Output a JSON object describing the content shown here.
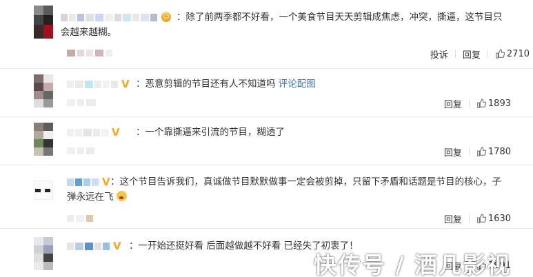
{
  "comments": [
    {
      "text": "：除了前两季都不好看，一个美食节目天天剪辑成焦虑，冲突，撕逼，这节目只",
      "text_line2": "会越来越糊。",
      "report_label": "投诉",
      "reply_label": "回复",
      "likes": "2710"
    },
    {
      "text": "：恶意剪辑的节目还有人不知道吗 ",
      "link": "评论配图",
      "reply_label": "回复",
      "likes": "1893"
    },
    {
      "text": "：一个靠撕逼来引流的节目，糊透了",
      "reply_label": "回复",
      "likes": "1780"
    },
    {
      "text": "：这个节目告诉我们，真诚做节目默默做事一定会被剪掉，只留下矛盾和话题是节目的核心，子",
      "text_line2": "弹永远在飞",
      "reply_label": "回复",
      "likes": "1630"
    },
    {
      "text": "：一开始还挺好看 后面越做越不好看 已经失了初衷了！",
      "reply_label": "回复",
      "likes": "1691"
    }
  ],
  "watermark": "快传号 / 酒几影视",
  "colors": {
    "link": "#3f6fb4",
    "vip_badge": "#f5a623",
    "text": "#333333"
  }
}
